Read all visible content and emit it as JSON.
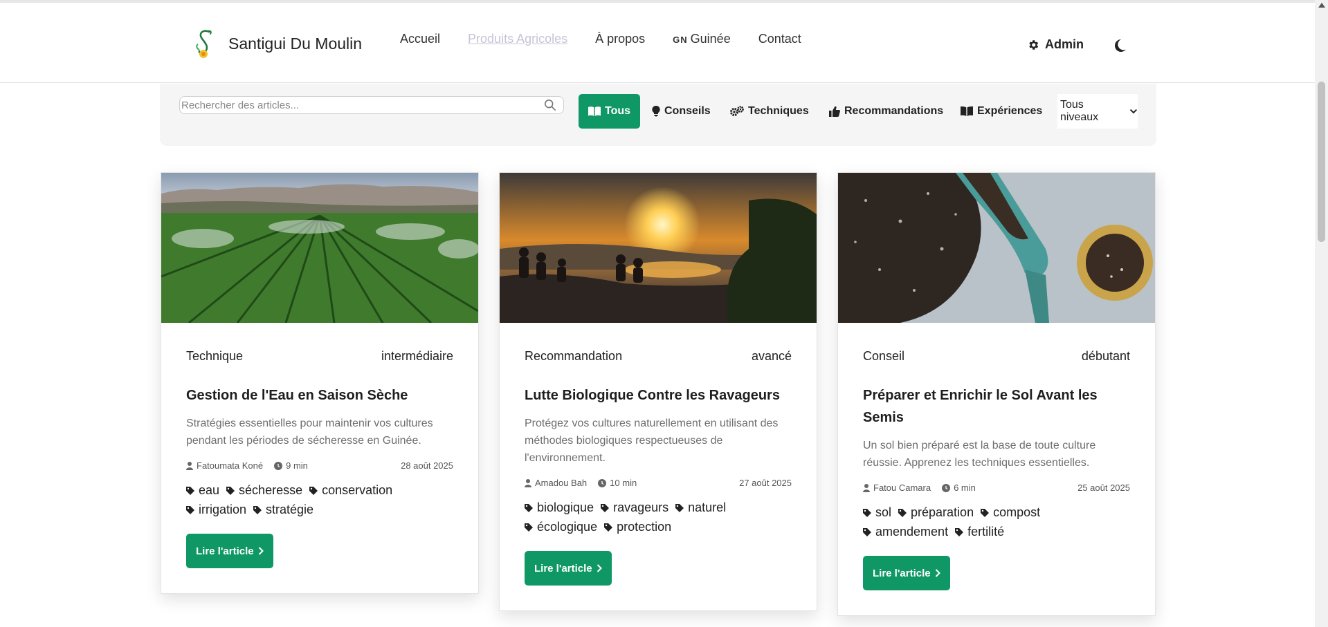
{
  "header": {
    "brand_name": "Santigui Du Moulin",
    "nav": [
      {
        "label": "Accueil",
        "active": false
      },
      {
        "label": "Produits Agricoles",
        "active": true
      },
      {
        "label": "À propos",
        "active": false
      },
      {
        "label": "Guinée",
        "flag": "GN",
        "active": false
      },
      {
        "label": "Contact",
        "active": false
      }
    ],
    "admin_label": "Admin",
    "admin_icon": "gear-icon",
    "theme_icon": "moon-icon"
  },
  "filters": {
    "search_placeholder": "Rechercher des articles...",
    "search_value": "",
    "buttons": [
      {
        "label": "Tous",
        "icon": "open-book-icon",
        "active": true
      },
      {
        "label": "Conseils",
        "icon": "lightbulb-icon",
        "active": false
      },
      {
        "label": "Techniques",
        "icon": "gears-icon",
        "active": false
      },
      {
        "label": "Recommandations",
        "icon": "thumbs-up-icon",
        "active": false
      },
      {
        "label": "Expériences",
        "icon": "book-icon",
        "active": false
      }
    ],
    "level_select": "Tous niveaux"
  },
  "colors": {
    "accent_green": "#0f9866",
    "active_nav": "#c7c3d6"
  },
  "articles": [
    {
      "category": "Technique",
      "level": "intermédiaire",
      "title": "Gestion de l'Eau en Saison Sèche",
      "description": "Stratégies essentielles pour maintenir vos cultures pendant les périodes de sécheresse en Guinée.",
      "author": "Fatoumata Koné",
      "read_time": "9 min",
      "date": "28 août 2025",
      "tags": [
        "eau",
        "sécheresse",
        "conservation",
        "irrigation",
        "stratégie"
      ],
      "button": "Lire l'article",
      "image": "irrigated-crop-field-photo"
    },
    {
      "category": "Recommandation",
      "level": "avancé",
      "title": "Lutte Biologique Contre les Ravageurs",
      "description": "Protégez vos cultures naturellement en utilisant des méthodes biologiques respectueuses de l'environnement.",
      "author": "Amadou Bah",
      "read_time": "10 min",
      "date": "27 août 2025",
      "tags": [
        "biologique",
        "ravageurs",
        "naturel",
        "écologique",
        "protection"
      ],
      "button": "Lire l'article",
      "image": "sunset-hilltop-group-photo"
    },
    {
      "category": "Conseil",
      "level": "débutant",
      "title": "Préparer et Enrichir le Sol Avant les Semis",
      "description": "Un sol bien préparé est la base de toute culture réussie. Apprenez les techniques essentielles.",
      "author": "Fatou Camara",
      "read_time": "6 min",
      "date": "25 août 2025",
      "tags": [
        "sol",
        "préparation",
        "compost",
        "amendement",
        "fertilité"
      ],
      "button": "Lire l'article",
      "image": "soil-trowel-photo"
    }
  ]
}
